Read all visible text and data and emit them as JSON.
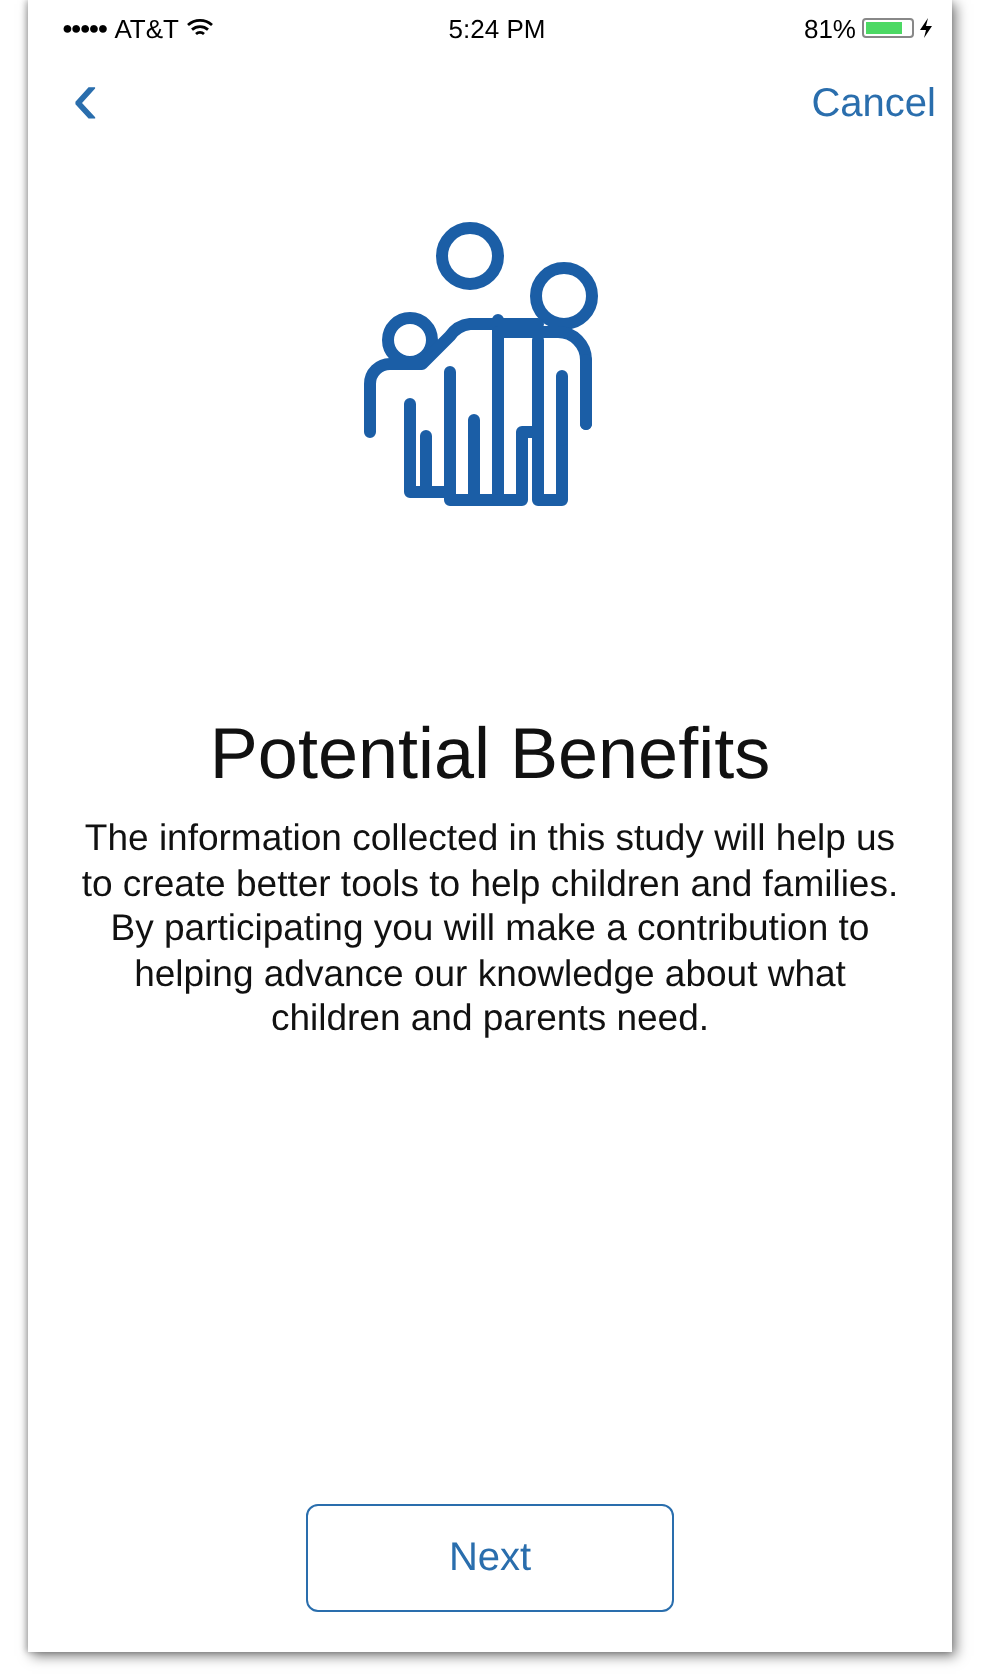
{
  "status_bar": {
    "signal_dots": "●●●●●",
    "carrier": "AT&T",
    "time": "5:24 PM",
    "battery_percent": "81%",
    "battery": {
      "level": 0.81
    }
  },
  "nav": {
    "back": "‹",
    "cancel": "Cancel"
  },
  "title": "Potential Benefits",
  "body": "The information collected in this study will help us to create better tools to help children and families. By participating you will make a contribution to helping advance our knowledge about what children and parents need.",
  "button": "Next"
}
